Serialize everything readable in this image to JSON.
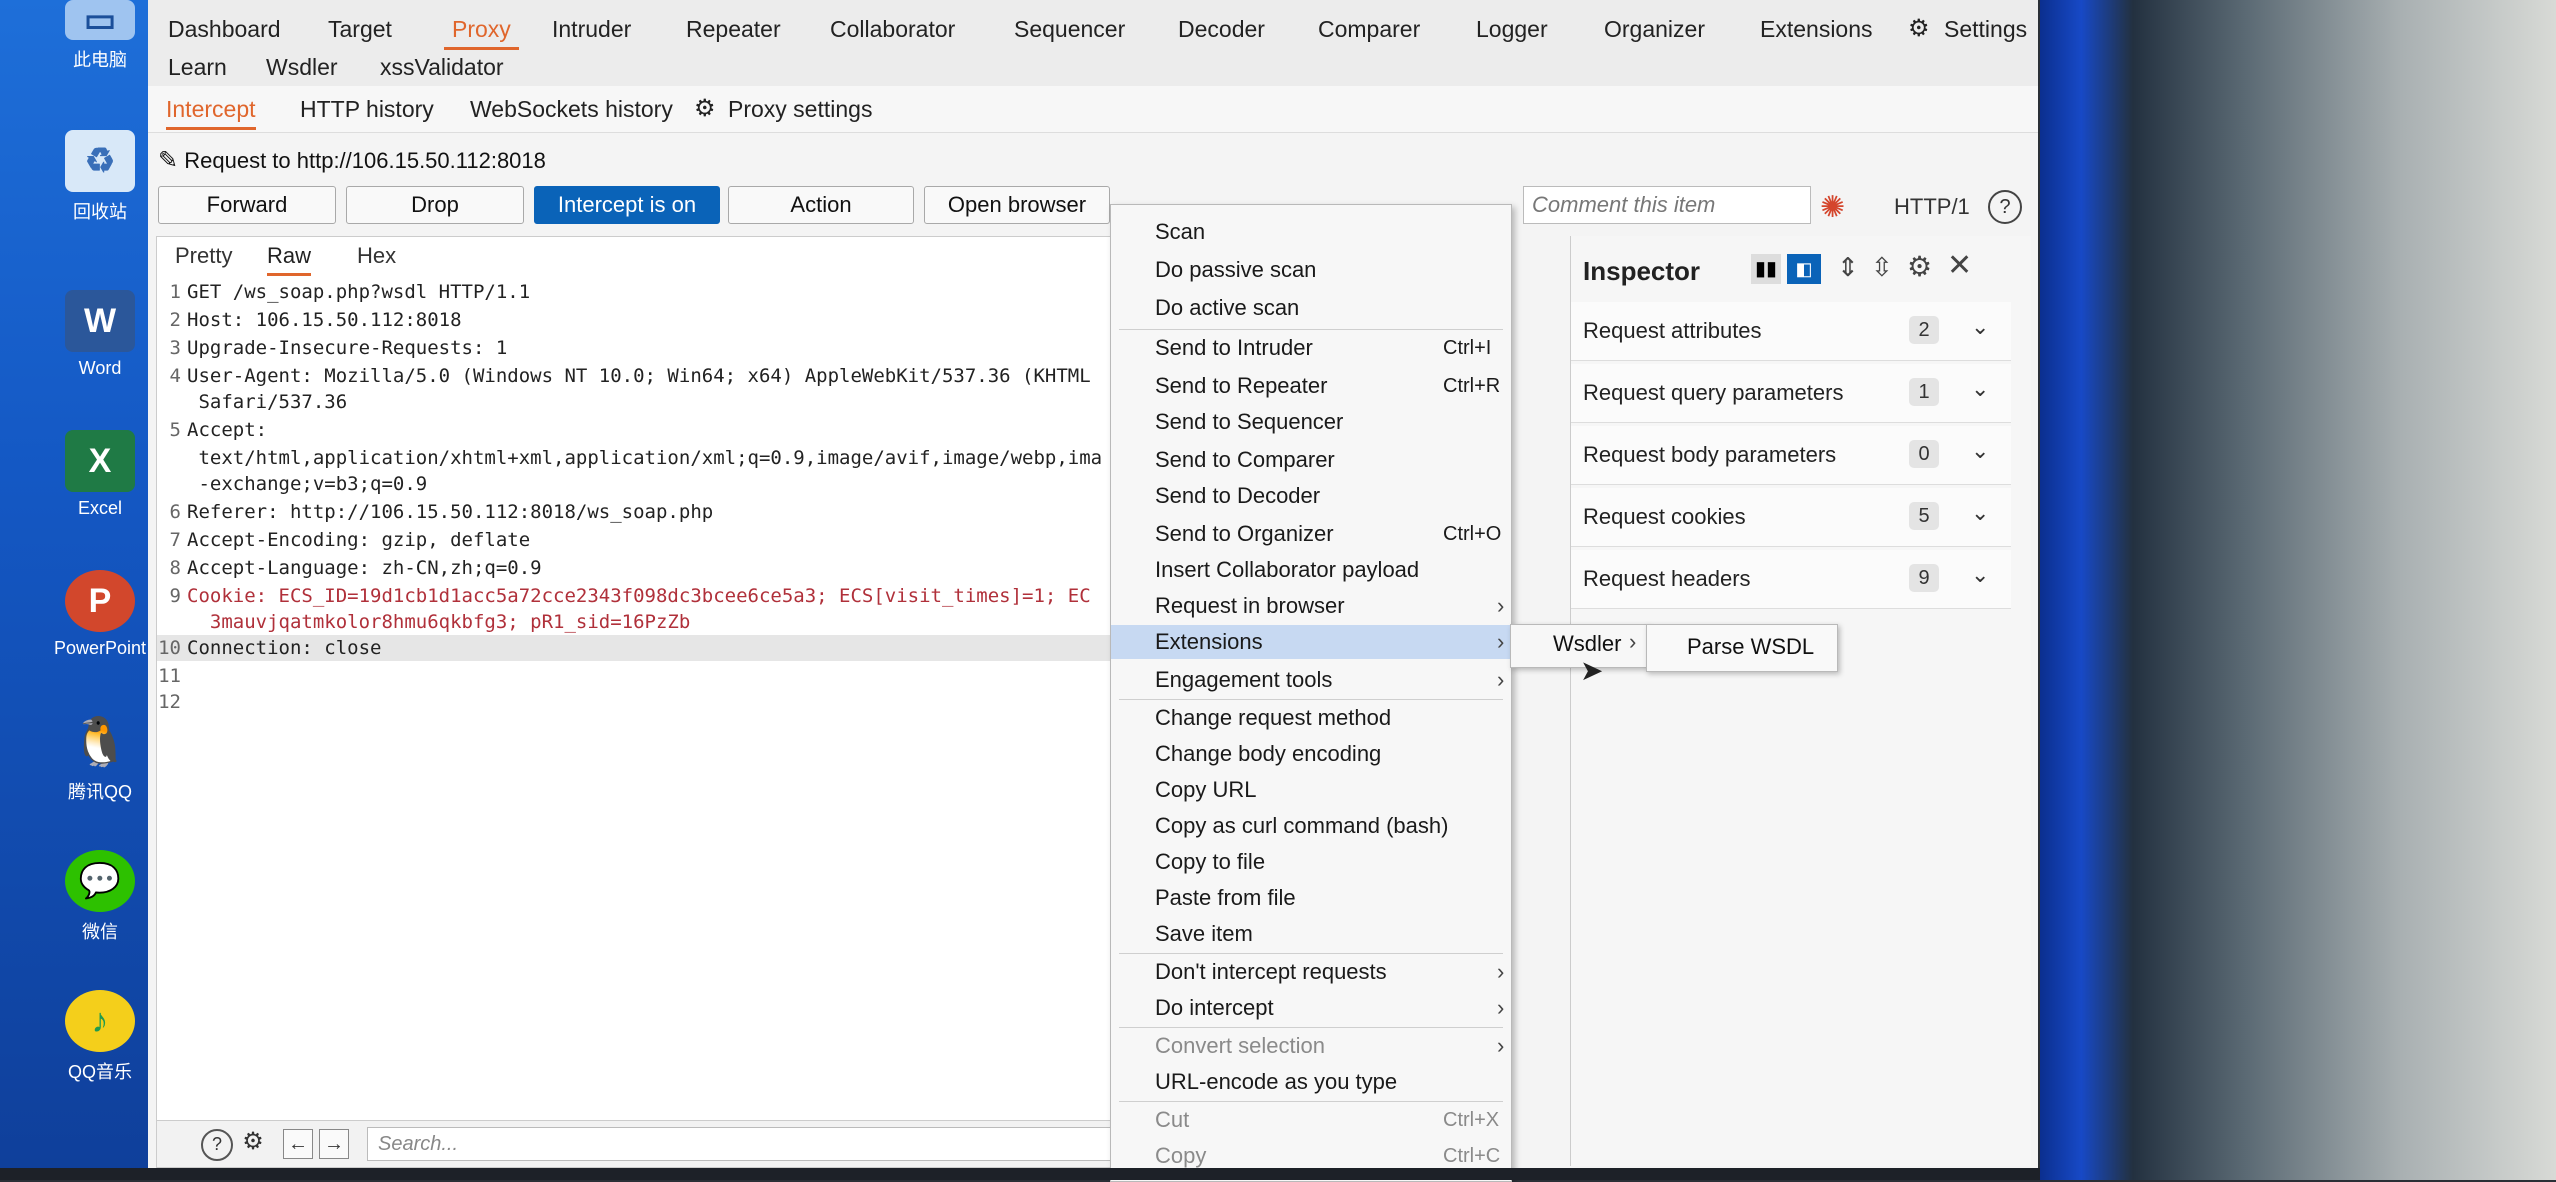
{
  "desktop": {
    "icons": [
      {
        "label": "此电脑",
        "icon": "computer-icon"
      },
      {
        "label": "回收站",
        "icon": "recycle-bin-icon"
      },
      {
        "label": "Word",
        "icon": "word-icon"
      },
      {
        "label": "Excel",
        "icon": "excel-icon"
      },
      {
        "label": "PowerPoint",
        "icon": "powerpoint-icon"
      },
      {
        "label": "腾讯QQ",
        "icon": "qq-icon"
      },
      {
        "label": "微信",
        "icon": "wechat-icon"
      },
      {
        "label": "QQ音乐",
        "icon": "qqmusic-icon"
      }
    ]
  },
  "menubar": {
    "row1": [
      "Dashboard",
      "Target",
      "Proxy",
      "Intruder",
      "Repeater",
      "Collaborator",
      "Sequencer",
      "Decoder",
      "Comparer",
      "Logger",
      "Organizer",
      "Extensions",
      "Settings"
    ],
    "row2": [
      "Learn",
      "Wsdler",
      "xssValidator"
    ],
    "active": "Proxy"
  },
  "proxy_tabs": [
    "Intercept",
    "HTTP history",
    "WebSockets history",
    "Proxy settings"
  ],
  "request_title": "Request to http://106.15.50.112:8018",
  "toolbar": {
    "forward": "Forward",
    "drop": "Drop",
    "intercept": "Intercept is on",
    "action": "Action",
    "open_browser": "Open browser",
    "comment_placeholder": "Comment this item",
    "http_version": "HTTP/1"
  },
  "editor": {
    "tabs": [
      "Pretty",
      "Raw",
      "Hex"
    ],
    "active_tab": "Raw",
    "lines": [
      {
        "n": "1",
        "text": "GET /ws_soap.php?wsdl HTTP/1.1"
      },
      {
        "n": "2",
        "text": "Host: 106.15.50.112:8018"
      },
      {
        "n": "3",
        "text": "Upgrade-Insecure-Requests: 1"
      },
      {
        "n": "4",
        "text": "User-Agent: Mozilla/5.0 (Windows NT 10.0; Win64; x64) AppleWebKit/537.36 (KHTML"
      },
      {
        "n": "",
        "text": " Safari/537.36"
      },
      {
        "n": "5",
        "text": "Accept:"
      },
      {
        "n": "",
        "text": " text/html,application/xhtml+xml,application/xml;q=0.9,image/avif,image/webp,ima"
      },
      {
        "n": "",
        "text": " -exchange;v=b3;q=0.9"
      },
      {
        "n": "6",
        "text": "Referer: http://106.15.50.112:8018/ws_soap.php"
      },
      {
        "n": "7",
        "text": "Accept-Encoding: gzip, deflate"
      },
      {
        "n": "8",
        "text": "Accept-Language: zh-CN,zh;q=0.9"
      },
      {
        "n": "9",
        "text": "Cookie: ECS_ID=19d1cb1d1acc5a72cce2343f098dc3bcee6ce5a3; ECS[visit_times]=1; EC"
      },
      {
        "n": "",
        "text": "  3mauvjqatmkolor8hmu6qkbfg3; pR1_sid=16PzZb"
      },
      {
        "n": "10",
        "text": "Connection: close"
      },
      {
        "n": "11",
        "text": ""
      },
      {
        "n": "12",
        "text": ""
      }
    ],
    "search_placeholder": "Search..."
  },
  "context_menu": {
    "items": [
      {
        "label": "Scan",
        "shortcut": "",
        "submenu": false
      },
      {
        "label": "Do passive scan",
        "shortcut": "",
        "submenu": false
      },
      {
        "label": "Do active scan",
        "shortcut": "",
        "submenu": false
      },
      {
        "label": "Send to Intruder",
        "shortcut": "Ctrl+I",
        "submenu": false
      },
      {
        "label": "Send to Repeater",
        "shortcut": "Ctrl+R",
        "submenu": false
      },
      {
        "label": "Send to Sequencer",
        "shortcut": "",
        "submenu": false
      },
      {
        "label": "Send to Comparer",
        "shortcut": "",
        "submenu": false
      },
      {
        "label": "Send to Decoder",
        "shortcut": "",
        "submenu": false
      },
      {
        "label": "Send to Organizer",
        "shortcut": "Ctrl+O",
        "submenu": false
      },
      {
        "label": "Insert Collaborator payload",
        "shortcut": "",
        "submenu": false
      },
      {
        "label": "Request in browser",
        "shortcut": "",
        "submenu": true
      },
      {
        "label": "Extensions",
        "shortcut": "",
        "submenu": true
      },
      {
        "label": "Engagement tools",
        "shortcut": "",
        "submenu": true
      },
      {
        "label": "Change request method",
        "shortcut": "",
        "submenu": false
      },
      {
        "label": "Change body encoding",
        "shortcut": "",
        "submenu": false
      },
      {
        "label": "Copy URL",
        "shortcut": "",
        "submenu": false
      },
      {
        "label": "Copy as curl command (bash)",
        "shortcut": "",
        "submenu": false
      },
      {
        "label": "Copy to file",
        "shortcut": "",
        "submenu": false
      },
      {
        "label": "Paste from file",
        "shortcut": "",
        "submenu": false
      },
      {
        "label": "Save item",
        "shortcut": "",
        "submenu": false
      },
      {
        "label": "Don't intercept requests",
        "shortcut": "",
        "submenu": true
      },
      {
        "label": "Do intercept",
        "shortcut": "",
        "submenu": true
      },
      {
        "label": "Convert selection",
        "shortcut": "",
        "submenu": true
      },
      {
        "label": "URL-encode as you type",
        "shortcut": "",
        "submenu": false
      },
      {
        "label": "Cut",
        "shortcut": "Ctrl+X",
        "submenu": false
      },
      {
        "label": "Copy",
        "shortcut": "Ctrl+C",
        "submenu": false
      }
    ],
    "selected": "Extensions",
    "submenu_extension": "Wsdler",
    "submenu_action": "Parse WSDL"
  },
  "inspector": {
    "title": "Inspector",
    "rows": [
      {
        "label": "Request attributes",
        "count": "2"
      },
      {
        "label": "Request query parameters",
        "count": "1"
      },
      {
        "label": "Request body parameters",
        "count": "0"
      },
      {
        "label": "Request cookies",
        "count": "5"
      },
      {
        "label": "Request headers",
        "count": "9"
      }
    ]
  },
  "colors": {
    "accent": "#e0662c",
    "primary_button": "#0a63b8",
    "menu_selection": "#c7d9f2"
  }
}
